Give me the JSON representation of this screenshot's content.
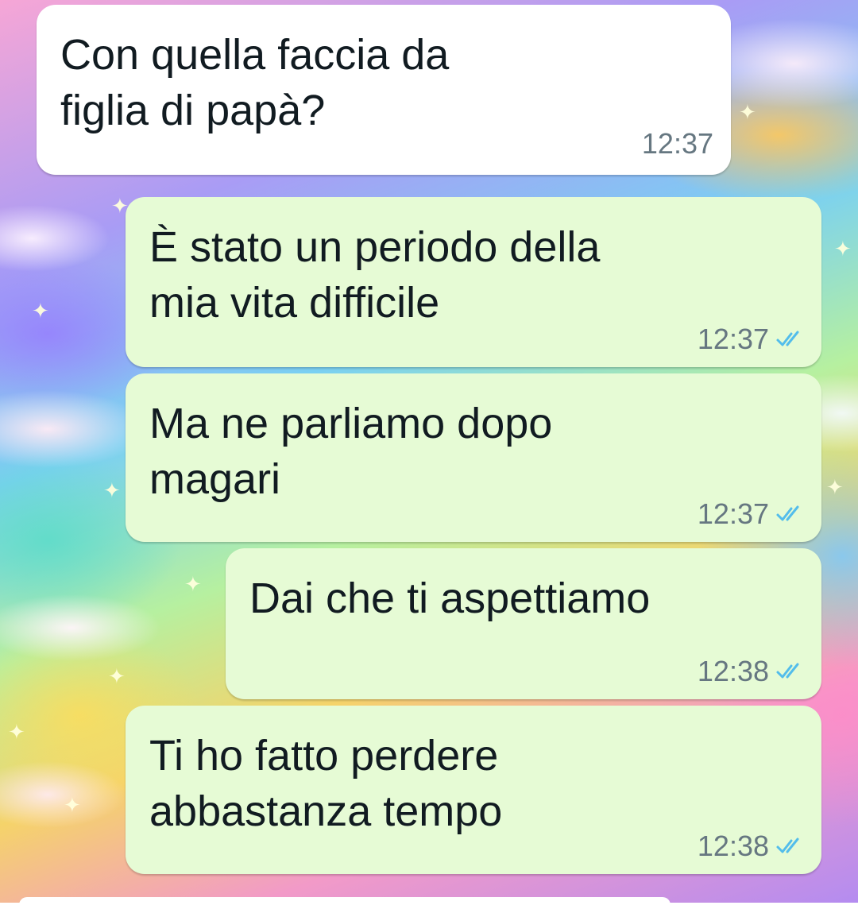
{
  "messages": [
    {
      "text": "Con quella faccia da\nfiglia di papà?",
      "time": "12:37",
      "direction": "incoming"
    },
    {
      "text": "È stato un periodo della\nmia vita difficile",
      "time": "12:37",
      "direction": "outgoing",
      "status": "read"
    },
    {
      "text": "Ma ne parliamo dopo\nmagari",
      "time": "12:37",
      "direction": "outgoing",
      "status": "read"
    },
    {
      "text": "Dai che ti aspettiamo",
      "time": "12:38",
      "direction": "outgoing",
      "status": "read"
    },
    {
      "text": "Ti ho fatto perdere\nabbastanza tempo",
      "time": "12:38",
      "direction": "outgoing",
      "status": "read"
    }
  ],
  "colors": {
    "incoming_bubble": "#ffffff",
    "outgoing_bubble": "#e6fbd5",
    "read_tick": "#53bdeb",
    "timestamp": "#667781"
  }
}
